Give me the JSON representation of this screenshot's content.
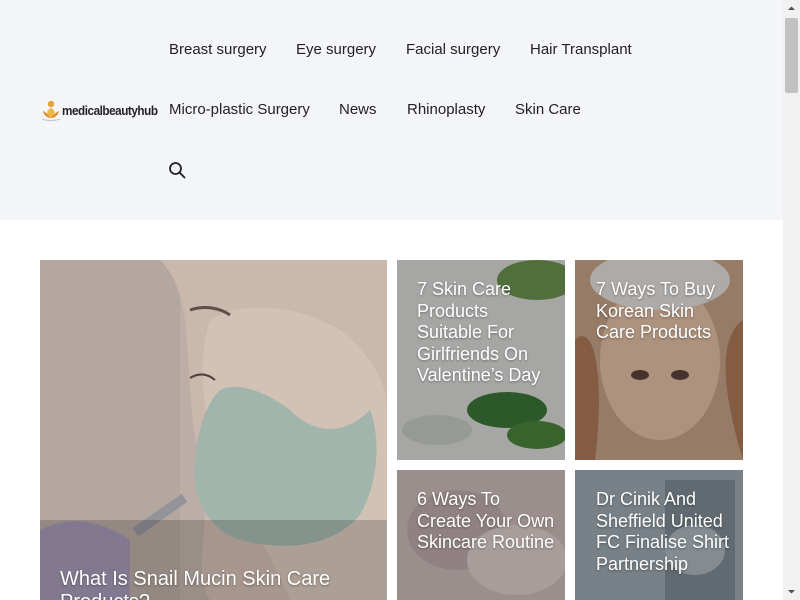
{
  "site": {
    "logo_text": "medicalbeautyhub"
  },
  "nav": {
    "items": [
      {
        "label": "Breast surgery"
      },
      {
        "label": "Eye surgery"
      },
      {
        "label": "Facial surgery"
      },
      {
        "label": "Hair Transplant"
      },
      {
        "label": "Micro-plastic Surgery"
      },
      {
        "label": "News"
      },
      {
        "label": "Rhinoplasty"
      },
      {
        "label": "Skin Care"
      }
    ],
    "search_icon": "search-icon"
  },
  "posts": [
    {
      "title": "What Is Snail Mucin Skin Care Products?"
    },
    {
      "title": "7 Skin Care Products Suitable For Girlfriends On Valentine’s Day"
    },
    {
      "title": "7 Ways To Buy Korean Skin Care Products"
    },
    {
      "title": "6 Ways To Create Your Own Skincare Routine"
    },
    {
      "title": "Dr Cinik And Sheffield United FC Finalise Shirt Partnership"
    }
  ]
}
